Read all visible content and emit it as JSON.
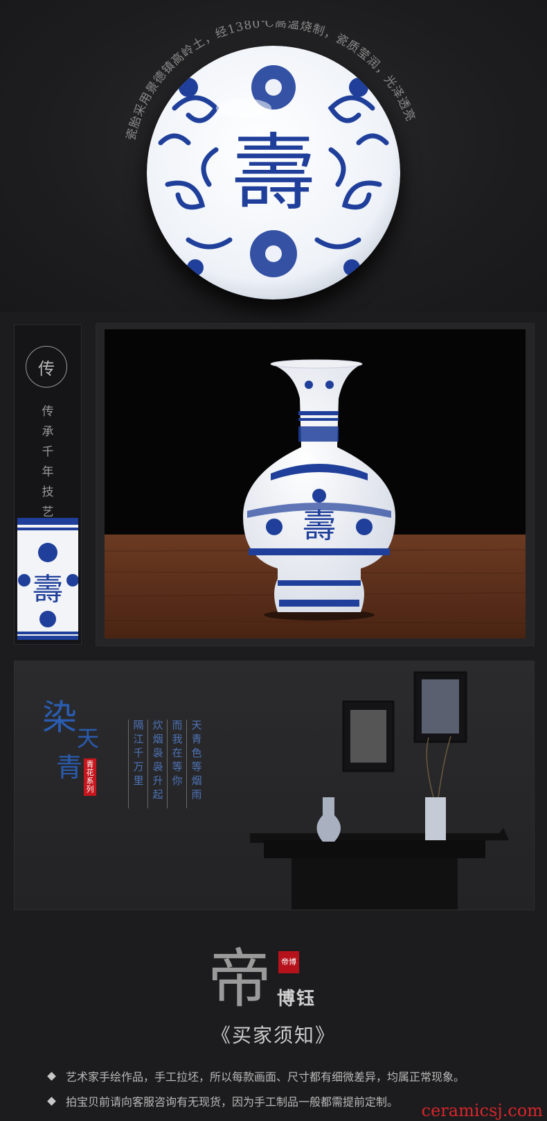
{
  "plate_section": {
    "arc_caption": "瓷胎采用景德镇高岭土，经1380℃高温烧制，瓷质莹润，光泽透亮"
  },
  "craft_section": {
    "seal_char": "传",
    "slogan_chars": [
      "传",
      "承",
      "千",
      "年",
      "技",
      "艺"
    ]
  },
  "poem_section": {
    "title_chars": [
      "染",
      "天",
      "青"
    ],
    "series_tag": "青花系列",
    "columns": [
      "天青色等烟雨",
      "而我在等你",
      "炊烟袅袅升起",
      "隔江千万里"
    ]
  },
  "notice_section": {
    "brand_big": "帝",
    "brand_seal": "帝博",
    "brand_name": "博钰",
    "title": "《买家须知》",
    "items": [
      "艺术家手绘作品，手工拉坯，所以每款画面、尺寸都有细微差异，均属正常现象。",
      "拍宝贝前请向客服咨询有无现货，因为手工制品一般都需提前定制。"
    ]
  },
  "watermark": "ceramicsj.com",
  "colors": {
    "background": "#1c1c1e",
    "cobalt": "#1f3f9a",
    "poem_blue": "#4f74b8",
    "seal_red": "#b5121b",
    "watermark_red": "#d8252b"
  }
}
